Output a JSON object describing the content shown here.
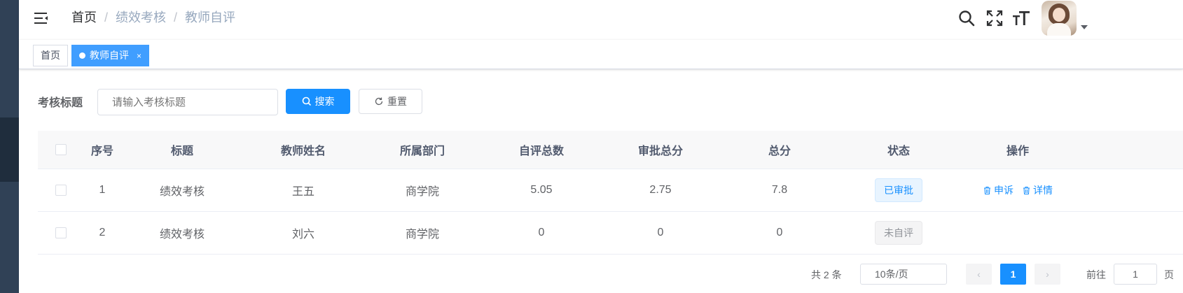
{
  "breadcrumb": {
    "items": [
      "首页",
      "绩效考核",
      "教师自评"
    ],
    "sep": "/"
  },
  "tags": {
    "home": "首页",
    "active": "教师自评",
    "close": "×"
  },
  "search": {
    "label": "考核标题",
    "placeholder": "请输入考核标题",
    "search_btn": "搜索",
    "reset_btn": "重置"
  },
  "table": {
    "headers": [
      "序号",
      "标题",
      "教师姓名",
      "所属部门",
      "自评总数",
      "审批总分",
      "总分",
      "状态",
      "操作"
    ],
    "rows": [
      {
        "index": "1",
        "title": "绩效考核",
        "teacher": "王五",
        "dept": "商学院",
        "self": "5.05",
        "approve": "2.75",
        "total": "7.8",
        "status": "已审批"
      },
      {
        "index": "2",
        "title": "绩效考核",
        "teacher": "刘六",
        "dept": "商学院",
        "self": "0",
        "approve": "0",
        "total": "0",
        "status": "未自评"
      }
    ],
    "ops": {
      "appeal": "申诉",
      "detail": "详情"
    }
  },
  "pagination": {
    "total": "共 2 条",
    "size": "10条/页",
    "page": "1",
    "goto": "前往",
    "jump": "1",
    "unit": "页",
    "prev": "‹",
    "next": "›"
  },
  "colors": {
    "primary": "#1890ff",
    "sidebar": "#304156",
    "tag_active": "#42b983"
  }
}
